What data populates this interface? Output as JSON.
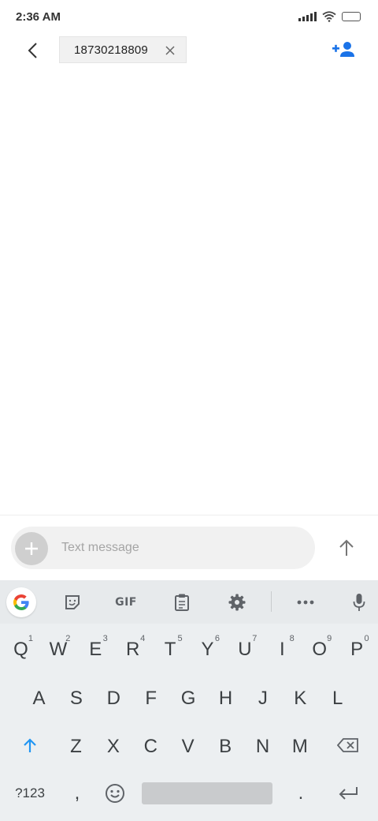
{
  "status_bar": {
    "time": "2:36 AM"
  },
  "header": {
    "recipient": "18730218809"
  },
  "composer": {
    "placeholder": "Text message"
  },
  "keyboard": {
    "toolbar": {
      "gif_label": "GIF"
    },
    "row1": [
      {
        "label": "Q",
        "hint": "1"
      },
      {
        "label": "W",
        "hint": "2"
      },
      {
        "label": "E",
        "hint": "3"
      },
      {
        "label": "R",
        "hint": "4"
      },
      {
        "label": "T",
        "hint": "5"
      },
      {
        "label": "Y",
        "hint": "6"
      },
      {
        "label": "U",
        "hint": "7"
      },
      {
        "label": "I",
        "hint": "8"
      },
      {
        "label": "O",
        "hint": "9"
      },
      {
        "label": "P",
        "hint": "0"
      }
    ],
    "row2": [
      "A",
      "S",
      "D",
      "F",
      "G",
      "H",
      "J",
      "K",
      "L"
    ],
    "row3": [
      "Z",
      "X",
      "C",
      "V",
      "B",
      "N",
      "M"
    ],
    "row4": {
      "symbols": "?123",
      "comma": ",",
      "period": "."
    }
  },
  "colors": {
    "accent": "#1a73e8",
    "shift_active": "#2196f3",
    "keyboard_bg": "#eceff1"
  },
  "icons": {
    "back": "chevron-left-icon",
    "add_contact": "person-add-icon",
    "attach": "plus-icon",
    "send": "arrow-up-icon",
    "google": "google-g-icon",
    "sticker": "sticker-icon",
    "clipboard": "clipboard-icon",
    "settings": "gear-icon",
    "more": "more-horizontal-icon",
    "mic": "microphone-icon",
    "shift": "shift-icon",
    "backspace": "backspace-icon",
    "emoji": "emoji-icon",
    "enter": "enter-icon"
  }
}
